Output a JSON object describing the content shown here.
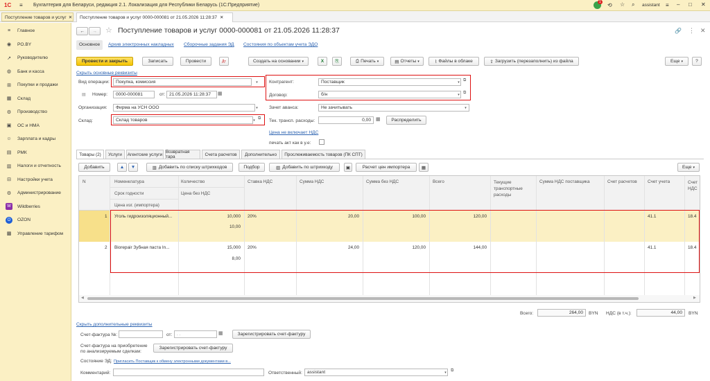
{
  "app": {
    "logo": "1С",
    "title": "Бухгалтерия для Беларуси, редакция 2.1. Локализация для Республики Беларусь   (1С:Предприятие)",
    "user": "assistant",
    "notification_count": "1"
  },
  "tabs": [
    {
      "label": "Поступление товаров и услуг"
    },
    {
      "label": "Поступление товаров и услуг 0000-000081 от 21.05.2026 11:28:37"
    }
  ],
  "sidebar": {
    "items": [
      {
        "label": "Главное",
        "icon": "menu-icon"
      },
      {
        "label": "PO.BY",
        "icon": "po-icon"
      },
      {
        "label": "Руководителю",
        "icon": "chart-icon"
      },
      {
        "label": "Банк и касса",
        "icon": "bank-icon"
      },
      {
        "label": "Покупки и продажи",
        "icon": "cart-icon"
      },
      {
        "label": "Склад",
        "icon": "warehouse-icon"
      },
      {
        "label": "Производство",
        "icon": "factory-icon"
      },
      {
        "label": "ОС и НМА",
        "icon": "assets-icon"
      },
      {
        "label": "Зарплата и кадры",
        "icon": "people-icon"
      },
      {
        "label": "РМК",
        "icon": "cash-register-icon"
      },
      {
        "label": "Налоги и отчетность",
        "icon": "tax-icon"
      },
      {
        "label": "Настройки учета",
        "icon": "settings-icon"
      },
      {
        "label": "Администрирование",
        "icon": "gear-icon"
      },
      {
        "label": "Wildberries",
        "icon": "wildberries-icon"
      },
      {
        "label": "OZON",
        "icon": "ozon-icon"
      },
      {
        "label": "Управление тарифом",
        "icon": "tariff-icon"
      }
    ]
  },
  "doc": {
    "title": "Поступление товаров и услуг 0000-000081 от 21.05.2026 11:28:37",
    "subtabs": [
      "Основное",
      "Архив электронных накладных",
      "Сборочные задания ЭД",
      "Состояния по объектам учета ЭДО"
    ]
  },
  "toolbar": {
    "post_close": "Провести и закрыть",
    "save": "Записать",
    "post": "Провести",
    "create_based": "Создать на основании",
    "print": "Печать",
    "reports": "Отчеты",
    "cloud_files": "Файлы в облаке",
    "load_file": "Загрузить (перезаполнить) из файла",
    "more": "Еще"
  },
  "form": {
    "hide_link": "Скрыть основные реквизиты",
    "op_type_label": "Вид операции:",
    "op_type_value": "Покупка, комиссия",
    "number_label": "Номер:",
    "number_value": "0000-000081",
    "date_label": "от:",
    "date_value": "21.05.2026 11:28:37",
    "org_label": "Организация:",
    "org_value": "Фирма на УСН ООО",
    "warehouse_label": "Склад:",
    "warehouse_value": "Склад товаров",
    "contractor_label": "Контрагент:",
    "contractor_value": "Поставщик",
    "contract_label": "Договор:",
    "contract_value": "б/н",
    "advance_label": "Зачет аванса:",
    "advance_value": "Не зачитывать",
    "transport_label": "Тек. трансп. расходы:",
    "transport_value": "0,00",
    "distribute": "Распределить",
    "vat_link": "Цена не включает НДС",
    "print_act_label": "печать акт как в у.е:"
  },
  "content_tabs": [
    "Товары (2)",
    "Услуги",
    "Агентские услуги",
    "Возвратная тара",
    "Счета расчетов",
    "Дополнительно",
    "Прослеживаемость товаров (ПК СПТ)"
  ],
  "table_toolbar": {
    "add": "Добавить",
    "add_by_list": "Добавить по списку штрихкодов",
    "select": "Подбор",
    "add_by_barcode": "Добавить по штрихкоду",
    "import_price": "Расчет цен импортера",
    "more": "Еще"
  },
  "table": {
    "headers": {
      "n": "N",
      "nomenclature": "Номенклатура",
      "shelf_life": "Срок годности",
      "importer_price": "Цена изг. (импортера)",
      "quantity": "Количество",
      "price": "Цена без НДС",
      "vat_rate": "Ставка НДС",
      "vat_sum": "Сумма НДС",
      "sum_no_vat": "Сумма без НДС",
      "total": "Всего",
      "transport": "Текущие транспортные расходы",
      "supplier_vat": "Сумма НДС поставщика",
      "settle_account": "Счет расчетов",
      "account": "Счет учета",
      "vat_account": "Счет НДС"
    },
    "rows": [
      {
        "n": "1",
        "name": "Уголь гидроизоляционный...",
        "qty": "10,000",
        "price": "10,00",
        "vat_rate": "20%",
        "vat_sum": "20,00",
        "sum_no_vat": "100,00",
        "total": "120,00",
        "account": "41.1",
        "vat_account": "18.4"
      },
      {
        "n": "2",
        "name": "Biorepair Зубная паста In...",
        "qty": "15,000",
        "price": "8,00",
        "vat_rate": "20%",
        "vat_sum": "24,00",
        "sum_no_vat": "120,00",
        "total": "144,00",
        "account": "41.1",
        "vat_account": "18.4"
      }
    ]
  },
  "totals": {
    "total_label": "Всего:",
    "total_value": "264,00",
    "currency": "BYN",
    "vat_label": "НДС (в т.ч.):",
    "vat_value": "44,00",
    "vat_currency": "BYN"
  },
  "footer": {
    "hide_extra_link": "Скрыть дополнительные реквизиты",
    "invoice_label": "Счет-фактура №:",
    "invoice_from": "от:",
    "invoice_date_placeholder": "  .  .    ",
    "register_invoice": "Зарегистрировать счет-фактуру",
    "acq_invoice_label1": "Счет-фактура на приобретение",
    "acq_invoice_label2": "по анализируемым сделкам:",
    "register_invoice2": "Зарегистрировать счет-фактуру",
    "ed_state_label": "Состояние ЭД:",
    "ed_state_link": "Пригласить Поставщик к обмену электронными документами в...",
    "comment_label": "Комментарий:",
    "responsible_label": "Ответственный:",
    "responsible_value": "assistant"
  }
}
